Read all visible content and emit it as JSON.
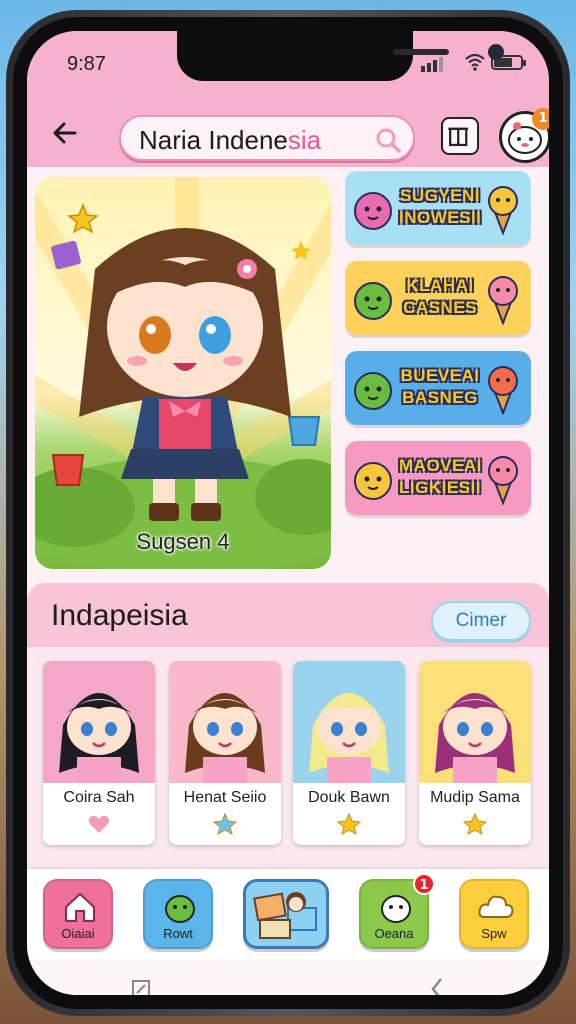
{
  "status": {
    "time": "9:87"
  },
  "header": {
    "search_value": "Naria Indene",
    "search_value_tail": "sia"
  },
  "hero": {
    "label": "Sugsen 4"
  },
  "banners": [
    {
      "text": "SUGYENI INOWESII",
      "bg": "#a9dff2"
    },
    {
      "text": "KLAHAI CASNES",
      "bg": "#fcd25a"
    },
    {
      "text": "BUEVEAI BASNEG",
      "bg": "#58aee6"
    },
    {
      "text": "MAOVEAI LIGKIESII",
      "bg": "#f79ac1"
    }
  ],
  "section": {
    "title": "Indapeisia",
    "more_label": "Cimer"
  },
  "characters": [
    {
      "name": "Coira Sah",
      "bg": "#f4a7c6",
      "hair": "#1c1c22",
      "icon": "heart-icon"
    },
    {
      "name": "Henat Seiio",
      "bg": "#f8b8c9",
      "hair": "#6b3b1d",
      "icon": "star-icon"
    },
    {
      "name": "Douk Bawn",
      "bg": "#9ad3ee",
      "hair": "#f2e98b",
      "icon": "star-icon"
    },
    {
      "name": "Mudip Sama",
      "bg": "#fbe07a",
      "hair": "#9c2f79",
      "icon": "star-icon"
    }
  ],
  "header_badge": "1",
  "tabs": [
    {
      "label": "Oiaiai",
      "color": "#f0709d",
      "icon": "home-icon"
    },
    {
      "label": "Rowt",
      "color": "#5bb4ea",
      "icon": "mascot-icon"
    },
    {
      "label": "",
      "color": "#8ed0f1",
      "icon": "character-photo-icon"
    },
    {
      "label": "Oeana",
      "color": "#8cc94a",
      "icon": "mascot-icon",
      "badge": "1"
    },
    {
      "label": "Spw",
      "color": "#fcce3b",
      "icon": "cloud-icon"
    }
  ]
}
